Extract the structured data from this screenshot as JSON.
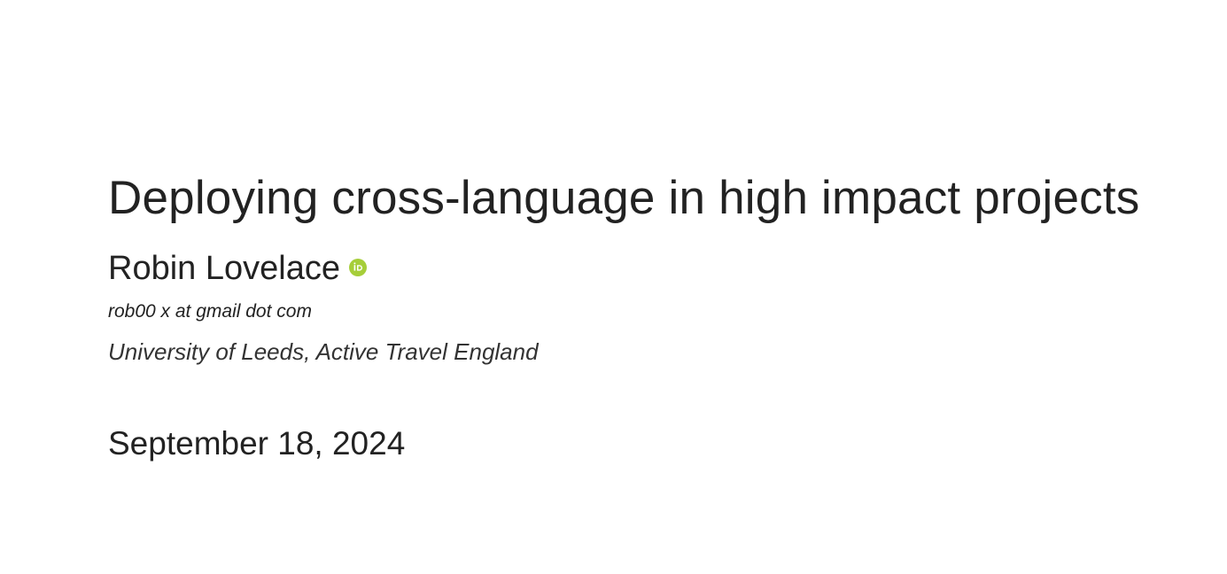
{
  "title": "Deploying cross-language in high impact projects",
  "author": {
    "name": "Robin Lovelace",
    "orcid_icon": "orcid-icon",
    "orcid_color": "#a6ce39",
    "email": "rob00 x at gmail dot com",
    "affiliation": "University of Leeds, Active Travel England"
  },
  "date": "September 18, 2024"
}
